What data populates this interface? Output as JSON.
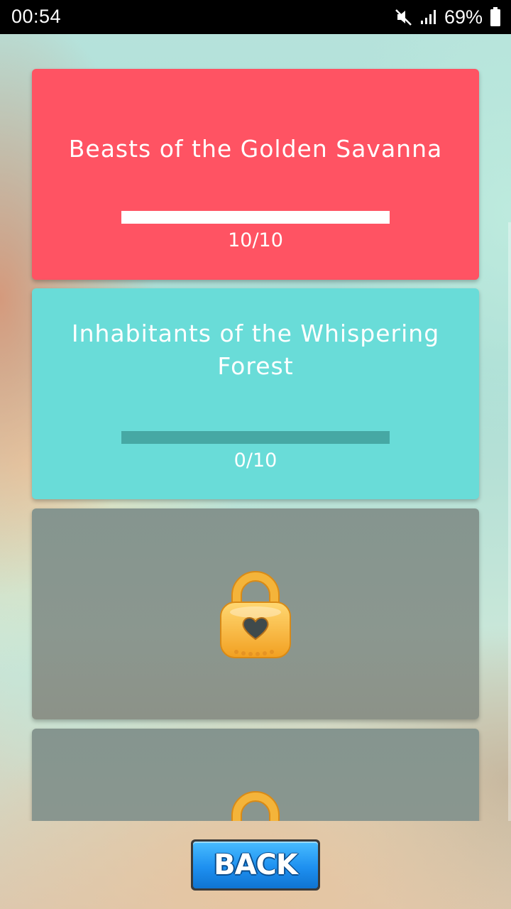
{
  "status_bar": {
    "time": "00:54",
    "battery_percent": "69%",
    "icons": [
      "mute-icon",
      "signal-icon",
      "battery-icon"
    ]
  },
  "colors": {
    "card_completed": "#ff5363",
    "card_active": "#69dcd8",
    "progress_track_completed": "#ff5363",
    "progress_fill_completed": "#ffffff",
    "progress_track_active": "#46a8a4",
    "locked_card": "#88948d",
    "back_button": "#1e90f0"
  },
  "categories": [
    {
      "title": "Beasts of the Golden Savanna",
      "progress_text": "10/10",
      "progress_fraction": 1.0,
      "locked": false
    },
    {
      "title": "Inhabitants of the Whispering Forest",
      "progress_text": "0/10",
      "progress_fraction": 0.0,
      "locked": false
    },
    {
      "title": "",
      "locked": true,
      "icon": "padlock-heart-icon"
    },
    {
      "title": "",
      "locked": true,
      "icon": "padlock-heart-icon"
    }
  ],
  "back_button": {
    "label": "BACK"
  }
}
